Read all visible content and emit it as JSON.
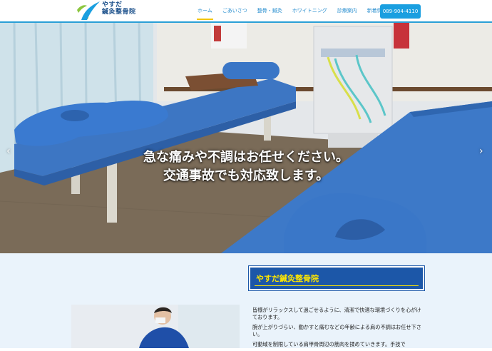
{
  "brand": {
    "line1": "やすだ",
    "line2": "鍼灸整骨院"
  },
  "nav": {
    "items": [
      {
        "label": "ホーム"
      },
      {
        "label": "ごあいさつ"
      },
      {
        "label": "整骨・鍼灸"
      },
      {
        "label": "ホワイトニング"
      },
      {
        "label": "診療案内"
      },
      {
        "label": "新着情報"
      }
    ],
    "phone": "089-904-4110"
  },
  "hero": {
    "line1": "急な痛みや不調はお任せください。",
    "line2": "交通事故でも対応致します。",
    "prev_glyph": "‹",
    "next_glyph": "›"
  },
  "section": {
    "title": "やすだ鍼灸整骨院",
    "paragraphs": [
      "皆様がリラックスして過ごせるように、清潔で快適な環境づくりを心がけております。",
      "腕が上がりづらい、動かすと痛むなどの年齢による肩の不調はお任せ下さい。",
      "可動域を制限している肩甲骨周辺の筋肉を揉めていきます。手技で"
    ]
  },
  "colors": {
    "accent": "#2a9fd6",
    "brand_blue": "#1c57a8",
    "highlight": "#ffe600"
  }
}
